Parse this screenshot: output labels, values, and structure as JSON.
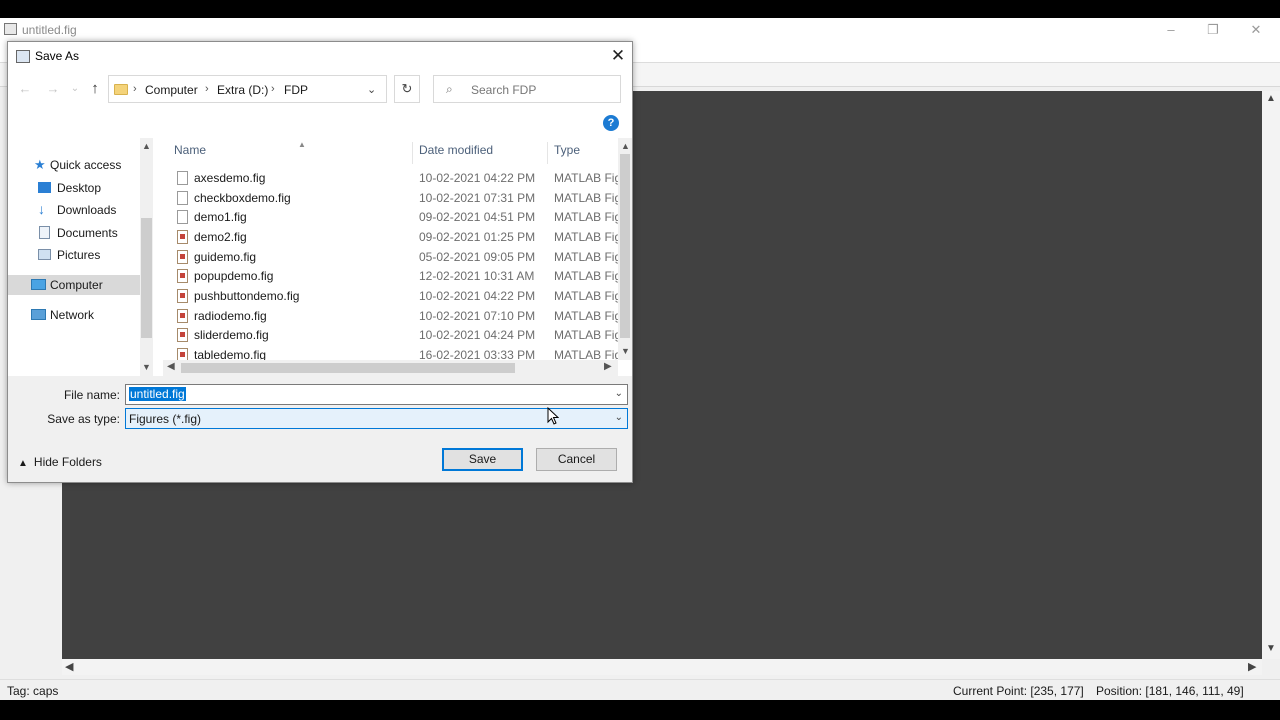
{
  "guide": {
    "title": "untitled.fig",
    "window_controls": {
      "minimize": "–",
      "restore": "❐",
      "close": "✕"
    },
    "status": {
      "tag": "Tag: caps",
      "current_point": "Current Point:  [235, 177]",
      "position": "Position: [181, 146, 111, 49]"
    }
  },
  "dialog": {
    "title": "Save As",
    "close_glyph": "✕",
    "nav": {
      "back": "←",
      "forward": "→",
      "recent": "⌄",
      "up": "↑",
      "refresh": "↻"
    },
    "breadcrumb": [
      "Computer",
      "Extra (D:)",
      "FDP"
    ],
    "breadcrumb_sep": "›",
    "search_placeholder": "Search FDP",
    "help_glyph": "?",
    "nav_pane": [
      {
        "label": "Quick access",
        "icon": "star-icon"
      },
      {
        "label": "Desktop",
        "icon": "desktop-icon"
      },
      {
        "label": "Downloads",
        "icon": "download-icon"
      },
      {
        "label": "Documents",
        "icon": "documents-icon"
      },
      {
        "label": "Pictures",
        "icon": "pictures-icon"
      },
      {
        "label": "Computer",
        "icon": "computer-icon",
        "selected": true
      },
      {
        "label": "Network",
        "icon": "network-icon"
      }
    ],
    "columns": {
      "name": "Name",
      "date": "Date modified",
      "type": "Type"
    },
    "files": [
      {
        "name": "axesdemo.fig",
        "date": "10-02-2021 04:22 PM",
        "type": "MATLAB Figure"
      },
      {
        "name": "checkboxdemo.fig",
        "date": "10-02-2021 07:31 PM",
        "type": "MATLAB Figure"
      },
      {
        "name": "demo1.fig",
        "date": "09-02-2021 04:51 PM",
        "type": "MATLAB Figure"
      },
      {
        "name": "demo2.fig",
        "date": "09-02-2021 01:25 PM",
        "type": "MATLAB Figure"
      },
      {
        "name": "guidemo.fig",
        "date": "05-02-2021 09:05 PM",
        "type": "MATLAB Figure"
      },
      {
        "name": "popupdemo.fig",
        "date": "12-02-2021 10:31 AM",
        "type": "MATLAB Figure"
      },
      {
        "name": "pushbuttondemo.fig",
        "date": "10-02-2021 04:22 PM",
        "type": "MATLAB Figure"
      },
      {
        "name": "radiodemo.fig",
        "date": "10-02-2021 07:10 PM",
        "type": "MATLAB Figure"
      },
      {
        "name": "sliderdemo.fig",
        "date": "10-02-2021 04:24 PM",
        "type": "MATLAB Figure"
      },
      {
        "name": "tabledemo.fig",
        "date": "16-02-2021 03:33 PM",
        "type": "MATLAB Figure"
      }
    ],
    "file_name_label": "File name:",
    "file_name_value": "untitled.fig",
    "save_type_label": "Save as type:",
    "save_type_value": "Figures (*.fig)",
    "hide_folders": "Hide Folders",
    "save_button": "Save",
    "cancel_button": "Cancel"
  }
}
